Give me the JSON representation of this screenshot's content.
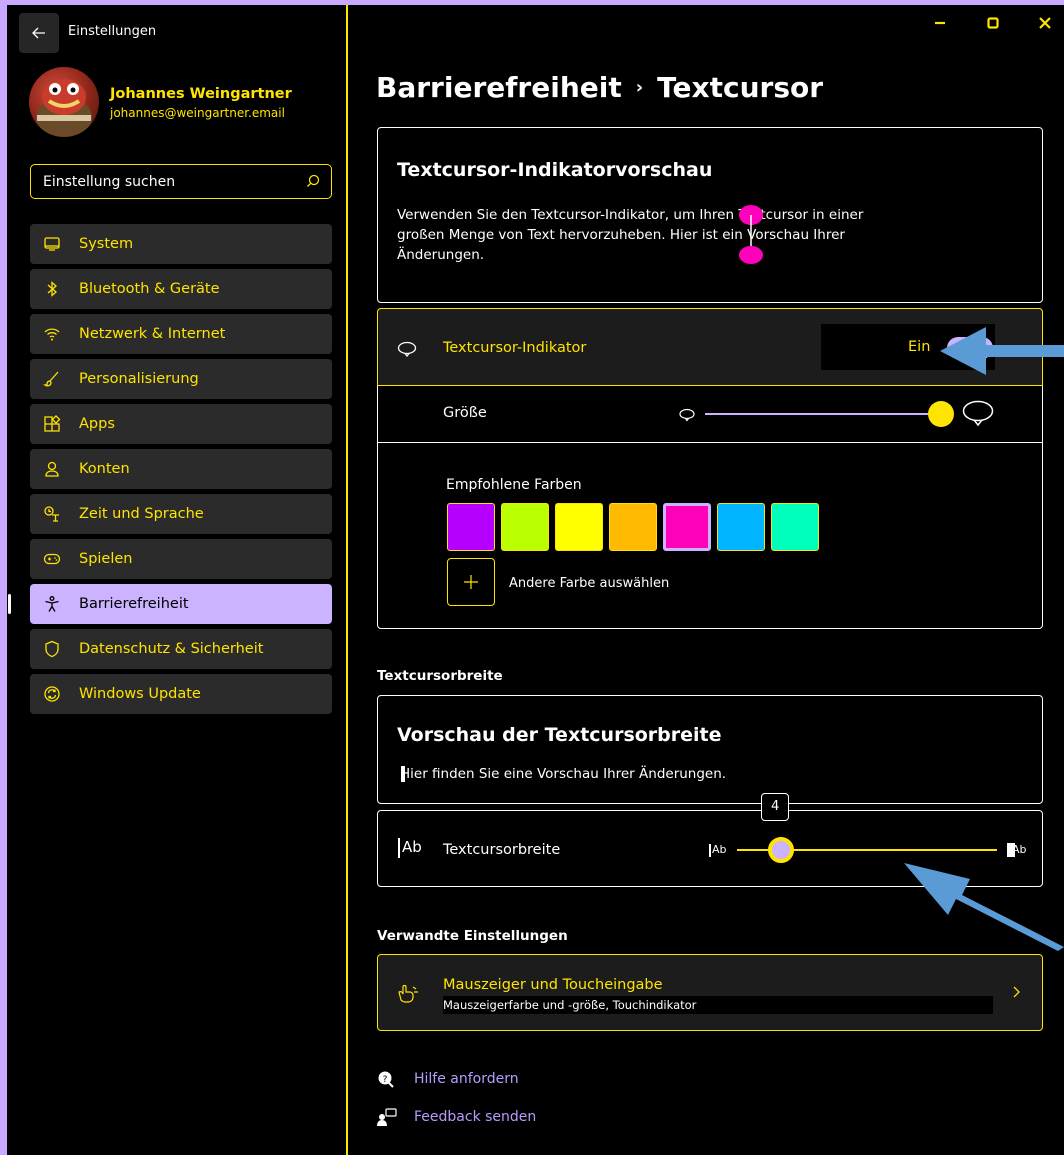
{
  "app": {
    "title": "Einstellungen"
  },
  "user": {
    "name": "Johannes Weingartner",
    "email": "johannes@weingartner.email"
  },
  "search": {
    "placeholder": "Einstellung suchen"
  },
  "nav": [
    {
      "label": "System",
      "icon": "monitor-icon"
    },
    {
      "label": "Bluetooth & Geräte",
      "icon": "bluetooth-icon"
    },
    {
      "label": "Netzwerk & Internet",
      "icon": "wifi-icon"
    },
    {
      "label": "Personalisierung",
      "icon": "brush-icon"
    },
    {
      "label": "Apps",
      "icon": "apps-icon"
    },
    {
      "label": "Konten",
      "icon": "person-icon"
    },
    {
      "label": "Zeit und Sprache",
      "icon": "language-icon"
    },
    {
      "label": "Spielen",
      "icon": "gamepad-icon"
    },
    {
      "label": "Barrierefreiheit",
      "icon": "accessibility-icon",
      "active": true
    },
    {
      "label": "Datenschutz & Sicherheit",
      "icon": "shield-icon"
    },
    {
      "label": "Windows Update",
      "icon": "update-icon"
    }
  ],
  "breadcrumb": {
    "parent": "Barrierefreiheit",
    "separator": "›",
    "current": "Textcursor"
  },
  "preview": {
    "title": "Textcursor-Indikatorvorschau",
    "text": "Verwenden Sie den Textcursor-Indikator, um Ihren Textcursor in einer großen Menge von Text hervorzuheben. Hier ist ein Vorschau Ihrer Änderungen."
  },
  "indicator": {
    "label": "Textcursor-Indikator",
    "state_label": "Ein",
    "on": true
  },
  "size": {
    "label": "Größe",
    "value_fraction": 1.0
  },
  "colors": {
    "label": "Empfohlene Farben",
    "swatches": [
      "#b600ff",
      "#b9ff00",
      "#ffff00",
      "#ffb900",
      "#ff00bb",
      "#00b4ff",
      "#00ffbb"
    ],
    "selected_index": 4,
    "add_label": "Andere Farbe auswählen"
  },
  "width_section": {
    "heading": "Textcursorbreite",
    "preview_title": "Vorschau der Textcursorbreite",
    "preview_text": "Hier finden Sie eine Vorschau Ihrer Änderungen.",
    "row_icon_text": "Ab",
    "row_label": "Textcursorbreite",
    "slider_min_label": "Ab",
    "slider_max_label": "Ab",
    "value": "4",
    "value_fraction": 0.17
  },
  "related": {
    "heading": "Verwandte Einstellungen",
    "title": "Mauszeiger und Toucheingabe",
    "subtitle": "Mauszeigerfarbe und -größe, Touchindikator"
  },
  "help": {
    "help_label": "Hilfe anfordern",
    "feedback_label": "Feedback senden"
  },
  "theme": {
    "accent": "#ffe400",
    "frame": "#c9a9ff",
    "annotation_arrow": "#5b9bd5"
  }
}
